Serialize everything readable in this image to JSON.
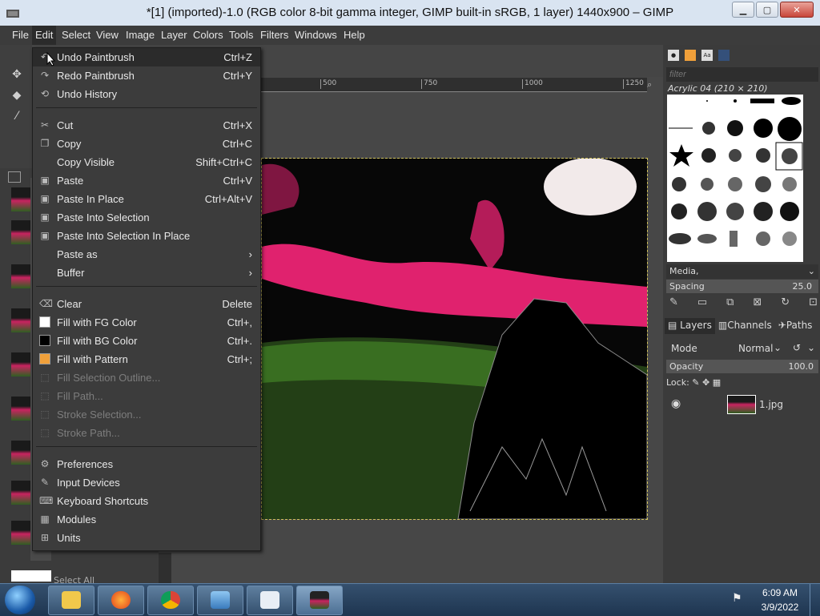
{
  "window": {
    "title": "*[1] (imported)-1.0 (RGB color 8-bit gamma integer, GIMP built-in sRGB, 1 layer) 1440x900 – GIMP",
    "controls": [
      "minimize-icon",
      "maximize-icon",
      "close-icon"
    ]
  },
  "menubar": [
    "File",
    "Edit",
    "Select",
    "View",
    "Image",
    "Layer",
    "Colors",
    "Tools",
    "Filters",
    "Windows",
    "Help"
  ],
  "ruler": {
    "ticks": [
      "500",
      "750",
      "1000",
      "1250"
    ]
  },
  "edit_menu": {
    "items": [
      {
        "label": "Undo Paintbrush",
        "shortcut": "Ctrl+Z",
        "icon": "undo-icon",
        "enabled": true,
        "highlighted": true
      },
      {
        "label": "Redo Paintbrush",
        "shortcut": "Ctrl+Y",
        "icon": "redo-icon",
        "enabled": true
      },
      {
        "label": "Undo History",
        "shortcut": "",
        "icon": "undo-history-icon",
        "enabled": true
      },
      {
        "label": "Cut",
        "shortcut": "Ctrl+X",
        "icon": "scissors-icon",
        "enabled": true
      },
      {
        "label": "Copy",
        "shortcut": "Ctrl+C",
        "icon": "copy-icon",
        "enabled": true
      },
      {
        "label": "Copy Visible",
        "shortcut": "Shift+Ctrl+C",
        "icon": "",
        "enabled": true
      },
      {
        "label": "Paste",
        "shortcut": "Ctrl+V",
        "icon": "paste-icon",
        "enabled": true
      },
      {
        "label": "Paste In Place",
        "shortcut": "Ctrl+Alt+V",
        "icon": "paste-in-place-icon",
        "enabled": true
      },
      {
        "label": "Paste Into Selection",
        "shortcut": "",
        "icon": "paste-into-icon",
        "enabled": true
      },
      {
        "label": "Paste Into Selection In Place",
        "shortcut": "",
        "icon": "paste-into-in-place-icon",
        "enabled": true
      },
      {
        "label": "Paste as",
        "shortcut": "",
        "icon": "",
        "enabled": true,
        "submenu": true
      },
      {
        "label": "Buffer",
        "shortcut": "",
        "icon": "",
        "enabled": true,
        "submenu": true
      },
      {
        "label": "Clear",
        "shortcut": "Delete",
        "icon": "clear-icon",
        "enabled": true
      },
      {
        "label": "Fill with FG Color",
        "shortcut": "Ctrl+,",
        "icon": "fg-swatch",
        "enabled": true
      },
      {
        "label": "Fill with BG Color",
        "shortcut": "Ctrl+.",
        "icon": "bg-swatch",
        "enabled": true
      },
      {
        "label": "Fill with Pattern",
        "shortcut": "Ctrl+;",
        "icon": "pattern-swatch",
        "enabled": true
      },
      {
        "label": "Fill Selection Outline...",
        "shortcut": "",
        "icon": "fill-outline-icon",
        "enabled": false
      },
      {
        "label": "Fill Path...",
        "shortcut": "",
        "icon": "fill-path-icon",
        "enabled": false
      },
      {
        "label": "Stroke Selection...",
        "shortcut": "",
        "icon": "stroke-selection-icon",
        "enabled": false
      },
      {
        "label": "Stroke Path...",
        "shortcut": "",
        "icon": "stroke-path-icon",
        "enabled": false
      },
      {
        "label": "Preferences",
        "shortcut": "",
        "icon": "preferences-icon",
        "enabled": true
      },
      {
        "label": "Input Devices",
        "shortcut": "",
        "icon": "input-devices-icon",
        "enabled": true
      },
      {
        "label": "Keyboard Shortcuts",
        "shortcut": "",
        "icon": "keyboard-icon",
        "enabled": true
      },
      {
        "label": "Modules",
        "shortcut": "",
        "icon": "modules-icon",
        "enabled": true
      },
      {
        "label": "Units",
        "shortcut": "",
        "icon": "units-icon",
        "enabled": true
      }
    ]
  },
  "left_dock": {
    "select_all": "Select All"
  },
  "brushes": {
    "filter_placeholder": "filter",
    "current_brush": "Acrylic 04 (210 × 210)",
    "tag": "Media,",
    "spacing_label": "Spacing",
    "spacing_value": "25.0"
  },
  "layers": {
    "tabs": [
      "Layers",
      "Channels",
      "Paths"
    ],
    "mode_label": "Mode",
    "mode_value": "Normal",
    "opacity_label": "Opacity",
    "opacity_value": "100.0",
    "lock_label": "Lock:",
    "layer_name": "1.jpg"
  },
  "taskbar": {
    "apps": [
      "file-explorer",
      "firefox",
      "chrome",
      "photos",
      "notepad",
      "gimp"
    ],
    "time": "6:09 AM",
    "date": "3/9/2022"
  },
  "colors": {
    "menu_bg": "#3c3c3c",
    "highlight": "#2b2b2b",
    "accent_pink": "#e0226e",
    "grass": "#2f6a1e"
  }
}
